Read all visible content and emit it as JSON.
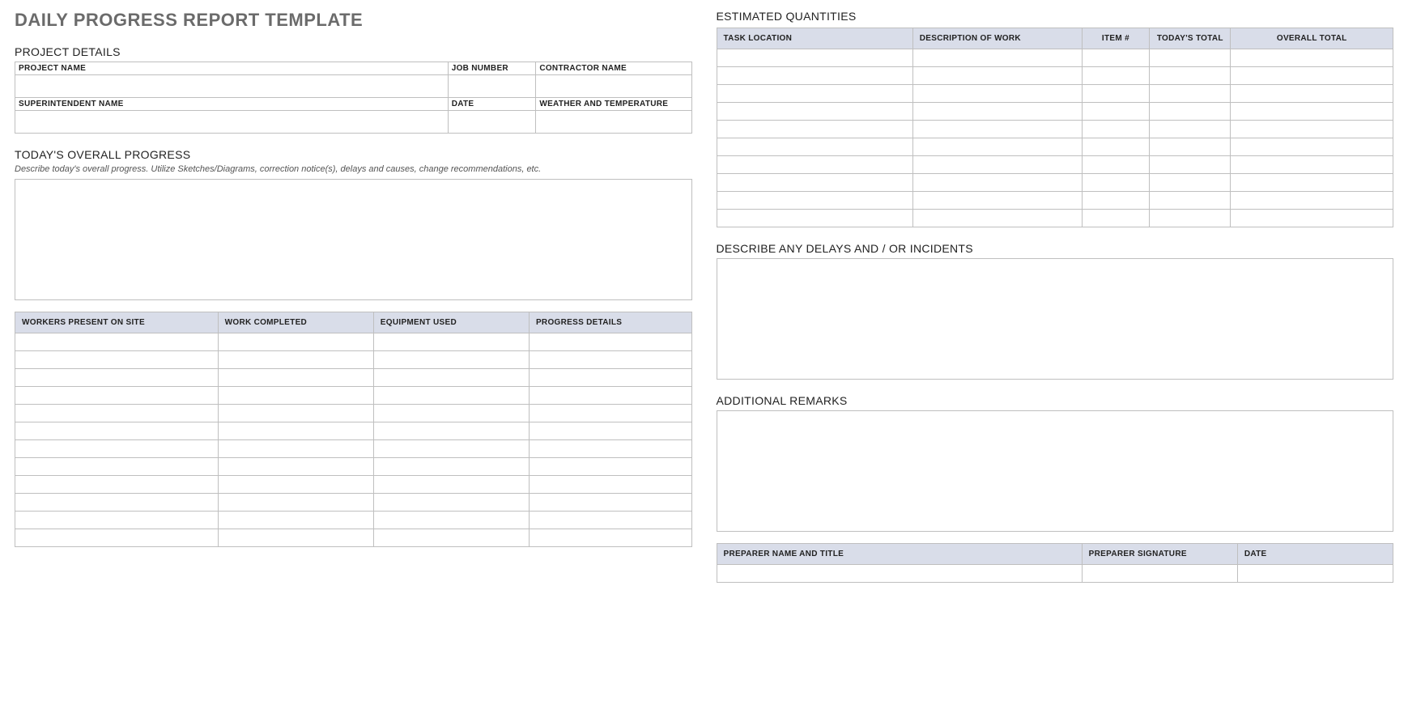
{
  "title": "DAILY PROGRESS REPORT TEMPLATE",
  "left": {
    "project_details_heading": "PROJECT DETAILS",
    "project_labels": {
      "project_name": "PROJECT NAME",
      "job_number": "JOB NUMBER",
      "contractor_name": "CONTRACTOR NAME",
      "superintendent_name": "SUPERINTENDENT NAME",
      "date": "DATE",
      "weather": "WEATHER AND TEMPERATURE"
    },
    "overall_heading": "TODAY'S OVERALL PROGRESS",
    "overall_hint": "Describe today's overall progress.  Utilize Sketches/Diagrams, correction notice(s), delays and causes, change recommendations, etc.",
    "workers_headers": {
      "c0": "WORKERS PRESENT ON SITE",
      "c1": "WORK COMPLETED",
      "c2": "EQUIPMENT USED",
      "c3": "PROGRESS DETAILS"
    }
  },
  "right": {
    "quantities_heading": "ESTIMATED QUANTITIES",
    "quantities_headers": {
      "c0": "TASK LOCATION",
      "c1": "DESCRIPTION OF WORK",
      "c2": "ITEM #",
      "c3": "TODAY'S TOTAL",
      "c4": "OVERALL TOTAL"
    },
    "delays_heading": "DESCRIBE ANY DELAYS AND / OR INCIDENTS",
    "remarks_heading": "ADDITIONAL REMARKS",
    "sig_headers": {
      "c0": "PREPARER NAME AND TITLE",
      "c1": "PREPARER SIGNATURE",
      "c2": "DATE"
    }
  }
}
